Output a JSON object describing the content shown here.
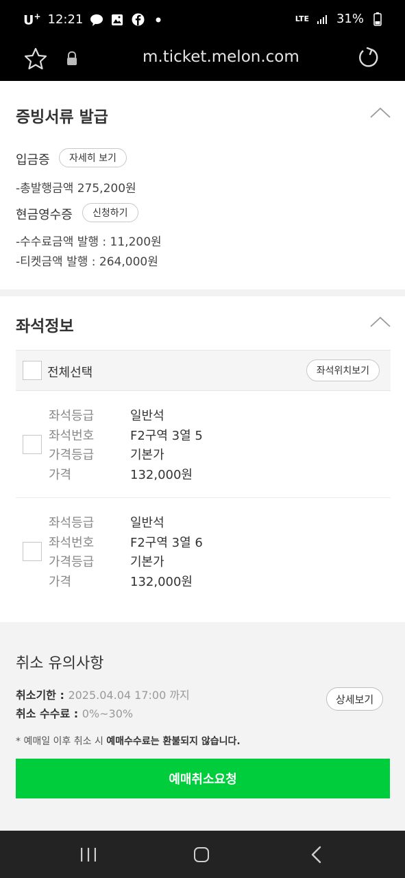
{
  "status_bar": {
    "carrier": "U",
    "carrier_sup": "+",
    "time": "12:21",
    "notification_icons": [
      "talk-icon",
      "image-icon",
      "facebook-icon",
      "dot-icon"
    ],
    "network": "LTE",
    "battery": "31%"
  },
  "browser": {
    "url": "m.ticket.melon.com"
  },
  "documents": {
    "title": "증빙서류 발급",
    "deposit_label": "입금증",
    "deposit_button": "자세히 보기",
    "deposit_total": "-총발행금액 275,200원",
    "receipt_label": "현금영수증",
    "receipt_button": "신청하기",
    "fee_line": "-수수료금액 발행 : 11,200원",
    "ticket_line": "-티켓금액 발행 : 264,000원"
  },
  "seat_info": {
    "title": "좌석정보",
    "select_all": "전체선택",
    "location_button": "좌석위치보기",
    "labels": {
      "grade": "좌석등급",
      "number": "좌석번호",
      "price_grade": "가격등급",
      "price": "가격"
    },
    "seats": [
      {
        "grade": "일반석",
        "number": "F2구역 3열 5",
        "price_grade": "기본가",
        "price": "132,000원"
      },
      {
        "grade": "일반석",
        "number": "F2구역 3열 6",
        "price_grade": "기본가",
        "price": "132,000원"
      }
    ]
  },
  "cancel": {
    "title": "취소 유의사항",
    "deadline_label": "취소기한",
    "deadline_value": "2025.04.04 17:00 까지",
    "fee_label": "취소 수수료",
    "fee_value": "0%~30%",
    "detail_button": "상세보기",
    "note_prefix": "* 예매일 이후 취소 시",
    "note_bold": "예매수수료는 환불되지 않습니다.",
    "cancel_button": "예매취소요청"
  },
  "colors": {
    "accent_green": "#00cd3c",
    "status_bar_bg": "#000000",
    "nav_bar_bg": "#232323"
  }
}
